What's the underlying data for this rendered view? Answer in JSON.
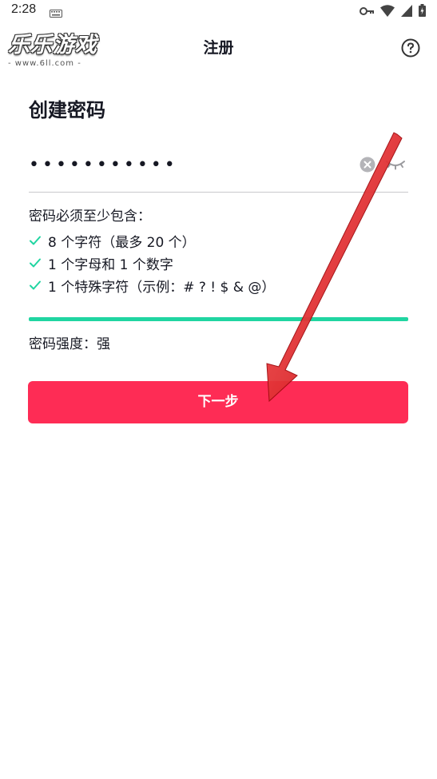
{
  "status_bar": {
    "time": "2:28",
    "icons": [
      "keyboard-icon",
      "key-icon",
      "wifi-icon",
      "signal-icon",
      "battery-icon"
    ]
  },
  "watermark": {
    "title": "乐乐游戏",
    "url": "- www.6ll.com -"
  },
  "header": {
    "title": "注册",
    "help_icon": "help-icon"
  },
  "form": {
    "heading": "创建密码",
    "password_value": "•••••••••••",
    "clear_icon": "clear-icon",
    "visibility_icon": "eye-closed-icon"
  },
  "requirements": {
    "title": "密码必须至少包含：",
    "items": [
      "8 个字符（最多 20 个）",
      "1 个字母和 1 个数字",
      "1 个特殊字符（示例：# ? ! $ & @）"
    ],
    "met": [
      true,
      true,
      true
    ]
  },
  "strength": {
    "label": "密码强度：",
    "value": "强",
    "level": 1.0
  },
  "next_button": {
    "label": "下一步"
  },
  "colors": {
    "accent": "#fe2c55",
    "success": "#20d5a1",
    "text": "#161823",
    "annotation_arrow": "#e8151b"
  }
}
